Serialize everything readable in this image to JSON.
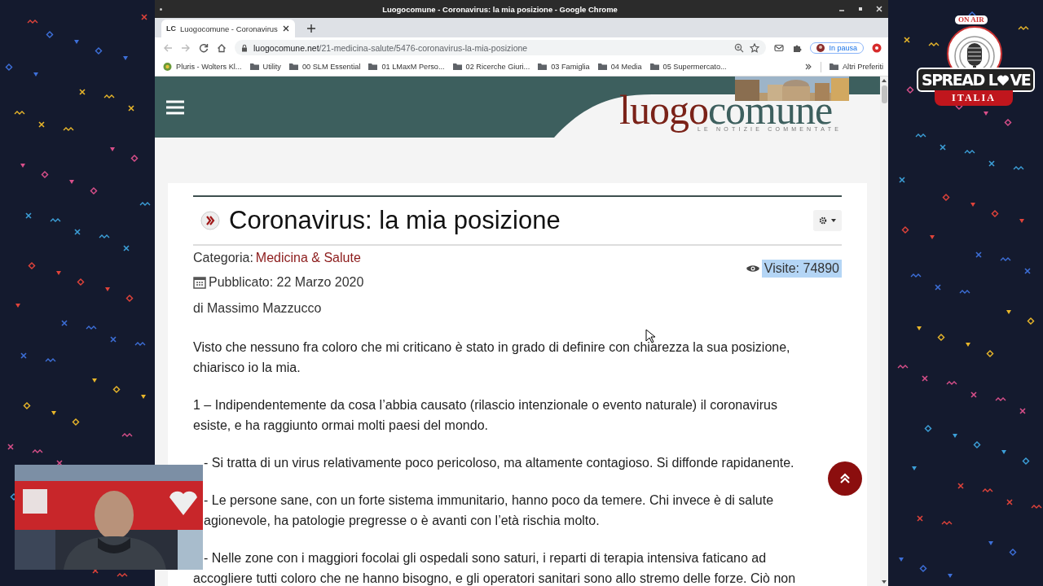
{
  "stream_overlay": {
    "logo": {
      "badge": "ON AIR",
      "word_start": "SPREAD L",
      "word_end": "VE",
      "ribbon": "ITALIA"
    }
  },
  "browser": {
    "window_title": "Luogocomune - Coronavirus: la mia posizione - Google Chrome",
    "tabs": [
      {
        "favicon": "LC",
        "title": "Luogocomune - Coronavirus",
        "selected": true
      }
    ],
    "url_host": "luogocomune.net",
    "url_path": "/21-medicina-salute/5476-coronavirus-la-mia-posizione",
    "profile": "In pausa",
    "bookmarks": [
      {
        "kind": "site",
        "label": "Pluris - Wolters Kl..."
      },
      {
        "kind": "folder",
        "label": "Utility"
      },
      {
        "kind": "folder",
        "label": "00 SLM Essential"
      },
      {
        "kind": "folder",
        "label": "01 LMaxM Perso..."
      },
      {
        "kind": "folder",
        "label": "02 Ricerche Giuri..."
      },
      {
        "kind": "folder",
        "label": "03 Famiglia"
      },
      {
        "kind": "folder",
        "label": "04 Media"
      },
      {
        "kind": "folder",
        "label": "05 Supermercato..."
      }
    ],
    "other_bookmarks": "Altri Preferiti"
  },
  "page": {
    "site_logo": {
      "first": "luogo",
      "second": "comune",
      "tagline": "LE NOTIZIE COMMENTATE"
    },
    "article": {
      "title": "Coronavirus: la mia posizione",
      "category_label": "Categoria:",
      "category": "Medicina & Salute",
      "published": "Pubblicato: 22 Marzo 2020",
      "visits": "Visite: 74890",
      "visits_selected": true,
      "author": "di Massimo Mazzucco",
      "paragraphs": [
        {
          "lines": [
            {
              "text": "Visto che nessuno fra coloro che mi criticano è stato in grado di definire con chiarezza la sua posizione,",
              "covered": false
            },
            {
              "text": "chiarisco io la mia.",
              "covered": false
            }
          ]
        },
        {
          "lines": [
            {
              "text": "1 – Indipendentemente da cosa l’abbia causato (rilascio intenzionale o evento naturale) il coronavirus",
              "covered": false
            },
            {
              "text": "esiste, e ha raggiunto ormai molti paesi del mondo.",
              "covered": false
            }
          ]
        },
        {
          "lines": [
            {
              "text": "- Si tratta di un virus relativamente poco pericoloso, ma altamente contagioso. Si diffonde rapidanente.",
              "covered": true
            }
          ]
        },
        {
          "lines": [
            {
              "text": "- Le persone sane, con un forte sistema immunitario, hanno poco da temere. Chi invece è di salute",
              "covered": true
            },
            {
              "text": "agionevole, ha patologie pregresse o è avanti con l’età rischia molto.",
              "covered": true
            }
          ]
        },
        {
          "lines": [
            {
              "text": "- Nelle zone con i maggiori focolai gli ospedali sono saturi, i reparti di terapia intensiva faticano ad",
              "covered": true
            },
            {
              "text": "accogliere tutti coloro che ne hanno bisogno, e gli operatori sanitari sono allo stremo delle forze. Ciò non",
              "covered": false
            }
          ]
        }
      ]
    }
  }
}
